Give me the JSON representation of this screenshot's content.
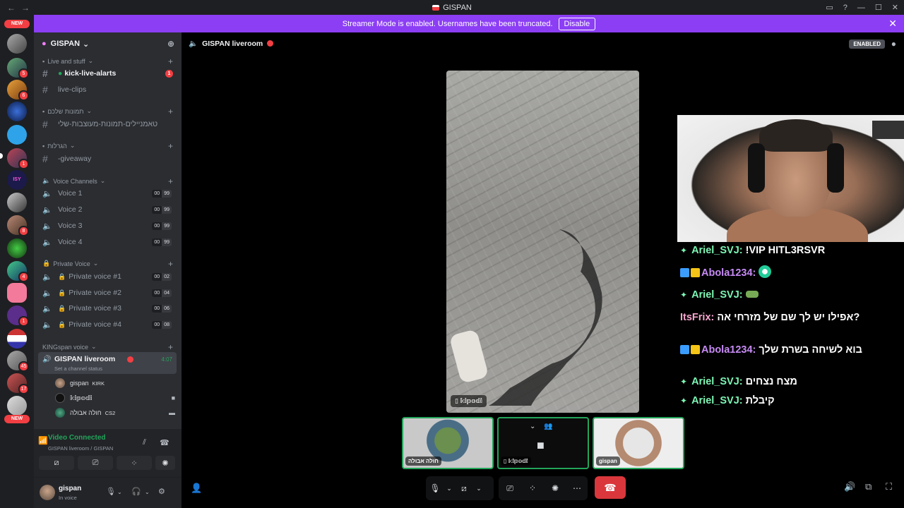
{
  "window": {
    "title": "GISPAN"
  },
  "banner": {
    "text": "Streamer Mode is enabled. Usernames have been truncated.",
    "button": "Disable"
  },
  "server_rail": {
    "new_top": "NEW",
    "new_bottom": "NEW",
    "badges": [
      "5",
      "6",
      "1",
      "8",
      "4",
      "1",
      "45",
      "17"
    ]
  },
  "server": {
    "name": "GISPAN"
  },
  "categories": {
    "live": "Live and stuff",
    "images": "תמונות שלכם",
    "giveaways": "הגרלות",
    "voice": "Voice Channels",
    "private": "Private Voice",
    "kingspan": "KINGspan voice"
  },
  "channels": {
    "kick": "kick-live-alarts",
    "kick_unread": "1",
    "clips": "live-clips",
    "thumbs": "טאמניילים-תמונות-מעוצבות-שלי",
    "giveaway": "-giveaway",
    "voice": [
      {
        "name": "Voice 1",
        "a": "00",
        "b": "99"
      },
      {
        "name": "Voice 2",
        "a": "00",
        "b": "99"
      },
      {
        "name": "Voice 3",
        "a": "00",
        "b": "99"
      },
      {
        "name": "Voice 4",
        "a": "00",
        "b": "99"
      }
    ],
    "private": [
      {
        "name": "Private voice #1",
        "a": "00",
        "b": "02"
      },
      {
        "name": "Private voice #2",
        "a": "00",
        "b": "04"
      },
      {
        "name": "Private voice #3",
        "a": "00",
        "b": "06"
      },
      {
        "name": "Private voice #4",
        "a": "00",
        "b": "08"
      }
    ],
    "active": {
      "name": "GISPAN liveroom",
      "status": "Set a channel status",
      "time": "4:07"
    }
  },
  "members": [
    {
      "name": "gispan",
      "tag": "KIRK"
    },
    {
      "name": "𝕜𝕚𝕡𝕠𝕕𝕚",
      "tag": ""
    },
    {
      "name": "חולה אבולה",
      "tag": "CS2"
    }
  ],
  "voice_panel": {
    "title": "Video Connected",
    "sub": "GISPAN liveroom / GISPAN"
  },
  "user": {
    "name": "gispan",
    "status": "In voice"
  },
  "stage": {
    "title": "GISPAN liveroom",
    "enabled": "ENABLED",
    "main_label": "𝕜𝕚𝕡𝕠𝕕𝕚"
  },
  "chat": [
    {
      "user": "Ariel_SVJ:",
      "text": "!VIP HITL3RSVR"
    },
    {
      "user": "Abola1234:",
      "text": ""
    },
    {
      "user": "Ariel_SVJ:",
      "text": ""
    },
    {
      "user": "ItsFrix:",
      "text": "אפילו יש לך שם של מזרחי אה?"
    },
    {
      "user": "Abola1234:",
      "text": "בוא לשיחה בשרת שלך"
    },
    {
      "user": "Ariel_SVJ:",
      "text": "מצח נצחים"
    },
    {
      "user": "Ariel_SVJ:",
      "text": "קיבלת"
    }
  ],
  "tiles": [
    {
      "label": "חולה אבולה"
    },
    {
      "label": "𝕜𝕚𝕡𝕠𝕕𝕚"
    },
    {
      "label": "gispan"
    }
  ],
  "colors": {
    "accent": "#8c3ef5",
    "green": "#23a55a",
    "red": "#da373c"
  }
}
